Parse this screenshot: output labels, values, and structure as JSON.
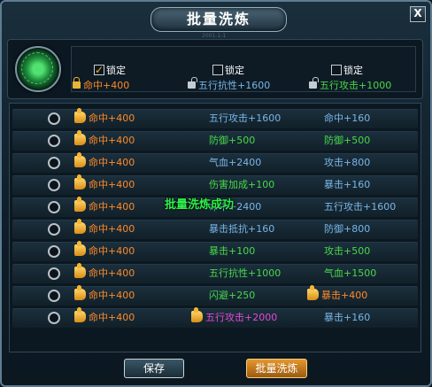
{
  "window": {
    "title": "批量洗炼",
    "subtitle": "2001-1-1",
    "close_label": "X"
  },
  "locks": [
    {
      "label": "锁定",
      "checked": true,
      "icon": "lock-closed-icon",
      "attr": "命中+400",
      "attr_color": "#ff8a2a"
    },
    {
      "label": "锁定",
      "checked": false,
      "icon": "lock-open-icon",
      "attr": "五行抗性+1600",
      "attr_color": "#79b6e8"
    },
    {
      "label": "锁定",
      "checked": false,
      "icon": "lock-open-icon",
      "attr": "五行攻击+1000",
      "attr_color": "#49d84a"
    }
  ],
  "rows": [
    {
      "a1": "命中+400",
      "a1c": "#ff8a2a",
      "a2": "五行攻击+1600",
      "a2c": "#79b6e8",
      "a3": "命中+160",
      "a3c": "#79b6e8"
    },
    {
      "a1": "命中+400",
      "a1c": "#ff8a2a",
      "a2": "防御+500",
      "a2c": "#49d84a",
      "a3": "防御+500",
      "a3c": "#49d84a"
    },
    {
      "a1": "命中+400",
      "a1c": "#ff8a2a",
      "a2": "气血+2400",
      "a2c": "#79b6e8",
      "a3": "攻击+800",
      "a3c": "#79b6e8"
    },
    {
      "a1": "命中+400",
      "a1c": "#ff8a2a",
      "a2": "伤害加成+100",
      "a2c": "#49d84a",
      "a3": "暴击+160",
      "a3c": "#79b6e8"
    },
    {
      "a1": "命中+400",
      "a1c": "#ff8a2a",
      "a2": "命中+2400",
      "a2c": "#79b6e8",
      "a3": "五行攻击+1600",
      "a3c": "#79b6e8"
    },
    {
      "a1": "命中+400",
      "a1c": "#ff8a2a",
      "a2": "暴击抵抗+160",
      "a2c": "#79b6e8",
      "a3": "防御+800",
      "a3c": "#79b6e8"
    },
    {
      "a1": "命中+400",
      "a1c": "#ff8a2a",
      "a2": "暴击+100",
      "a2c": "#49d84a",
      "a3": "攻击+500",
      "a3c": "#49d84a"
    },
    {
      "a1": "命中+400",
      "a1c": "#ff8a2a",
      "a2": "五行抗性+1000",
      "a2c": "#49d84a",
      "a3": "气血+1500",
      "a3c": "#49d84a"
    },
    {
      "a1": "命中+400",
      "a1c": "#ff8a2a",
      "a2": "闪避+250",
      "a2c": "#49d84a",
      "a3": "暴击+400",
      "a3c": "#ff8a2a",
      "a3thumb": true
    },
    {
      "a1": "命中+400",
      "a1c": "#ff8a2a",
      "a2": "五行攻击+2000",
      "a2c": "#e24ad8",
      "a2thumb": true,
      "a3": "暴击+160",
      "a3c": "#79b6e8"
    }
  ],
  "toast": "批量洗炼成功",
  "buttons": {
    "save": "保存",
    "batch_wash": "批量洗炼"
  },
  "colors": {
    "orange": "#ff8a2a",
    "blue": "#79b6e8",
    "green": "#49d84a",
    "purple": "#e24ad8",
    "toast_green": "#2ef04a"
  }
}
